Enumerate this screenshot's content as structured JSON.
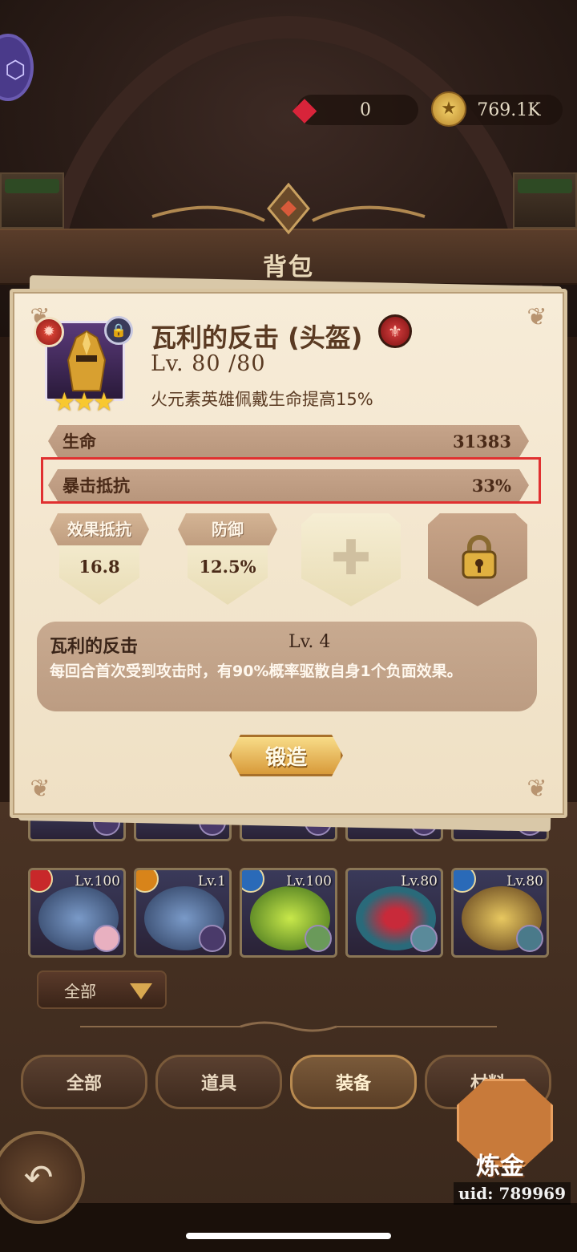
{
  "header": {
    "gems": "0",
    "gold": "769.1K",
    "title": "背包"
  },
  "item": {
    "name": "瓦利的反击 (头盔)",
    "level": "Lv. 80 /80",
    "description": "火元素英雄佩戴生命提高15%",
    "stars": "★★★"
  },
  "stats": {
    "main": [
      {
        "label": "生命",
        "value": "31383"
      },
      {
        "label": "暴击抵抗",
        "value": "33%"
      }
    ],
    "sub": [
      {
        "label": "效果抵抗",
        "value": "16.8"
      },
      {
        "label": "防御",
        "value": "12.5%"
      }
    ]
  },
  "skill": {
    "name": "瓦利的反击",
    "level": "Lv. 4",
    "description": "每回合首次受到攻击时，有90%概率驱散自身1个负面效果。"
  },
  "forge_label": "锻造",
  "grid": {
    "items": [
      {
        "level": "Lv.100",
        "element_color": "#c8282a",
        "art_color": "#3a5a8a"
      },
      {
        "level": "Lv.1",
        "element_color": "#d8841a",
        "art_color": "#3a5a8a"
      },
      {
        "level": "Lv.100",
        "element_color": "#2a6ab8",
        "art_color": "#5a9a2a"
      },
      {
        "level": "Lv.80",
        "element_color": "",
        "art_color": "#2a6a7a"
      },
      {
        "level": "Lv.80",
        "element_color": "#2a6ab8",
        "art_color": "#8a6a2a"
      }
    ]
  },
  "filter": {
    "label": "全部"
  },
  "tabs": [
    {
      "label": "全部",
      "active": false
    },
    {
      "label": "道具",
      "active": false
    },
    {
      "label": "装备",
      "active": true
    },
    {
      "label": "材料",
      "active": false
    }
  ],
  "alchemy_label": "炼金",
  "uid": "uid: 789969",
  "icons": {
    "gem": "ruby-gem-icon",
    "gold": "gold-coin-icon",
    "back": "back-arrow-icon",
    "lock": "padlock-icon",
    "plus": "plus-icon"
  },
  "colors": {
    "highlight": "#e03030",
    "panel": "#f7ecd8",
    "accent_gold": "#d89a3a"
  }
}
